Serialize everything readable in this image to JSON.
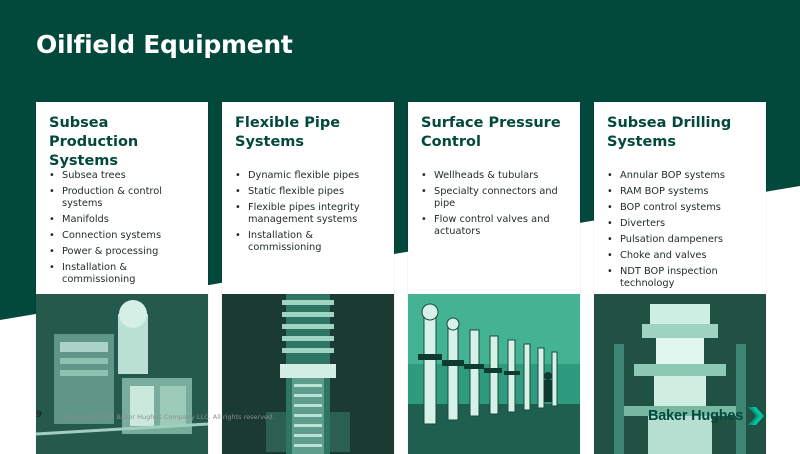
{
  "slide": {
    "title": "Oilfield Equipment",
    "page_number": "9",
    "copyright": "Copyright 2020 Baker Hughes Company LLC. All rights reserved.",
    "logo_text": "Baker Hughes",
    "colors": {
      "dark_green": "#02483b",
      "teal": "#2e9b7f",
      "bright_green": "#05c3a0"
    }
  },
  "cards": [
    {
      "title": "Subsea Production Systems",
      "items": [
        "Subsea trees",
        "Production & control systems",
        "Manifolds",
        "Connection systems",
        "Power & processing",
        "Installation & commissioning"
      ],
      "image_icon": "subsea-equipment-photo"
    },
    {
      "title": "Flexible Pipe Systems",
      "items": [
        "Dynamic flexible pipes",
        "Static flexible pipes",
        "Flexible pipes integrity management systems",
        "Installation & commissioning"
      ],
      "image_icon": "flexible-pipe-photo"
    },
    {
      "title": "Surface Pressure Control",
      "items": [
        "Wellheads & tubulars",
        "Specialty connectors and pipe",
        "Flow control valves and actuators"
      ],
      "image_icon": "wellhead-field-photo"
    },
    {
      "title": "Subsea Drilling Systems",
      "items": [
        "Annular BOP systems",
        "RAM BOP systems",
        "BOP control systems",
        "Diverters",
        "Pulsation dampeners",
        "Choke and valves",
        "NDT BOP inspection technology"
      ],
      "image_icon": "bop-stack-photo"
    }
  ]
}
